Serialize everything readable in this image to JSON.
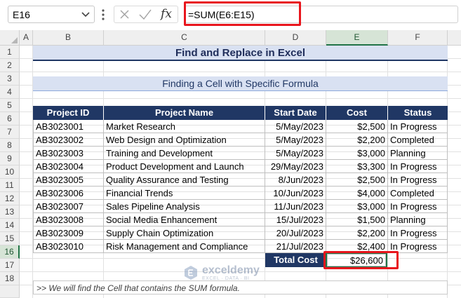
{
  "formula_bar": {
    "name_box": "E16",
    "formula": "=SUM(E6:E15)",
    "icons": [
      "chevron-down-icon",
      "kebab-icon",
      "cancel-x-icon",
      "enter-check-icon",
      "fx-icon"
    ]
  },
  "columns": [
    "A",
    "B",
    "C",
    "D",
    "E",
    "F"
  ],
  "rows": [
    "1",
    "2",
    "3",
    "4",
    "5",
    "6",
    "7",
    "8",
    "9",
    "10",
    "11",
    "12",
    "13",
    "14",
    "15",
    "16",
    "17",
    "18"
  ],
  "selected_column": "E",
  "selected_row": "16",
  "title": "Find and Replace in Excel",
  "subtitle": "Finding a Cell with Specific Formula",
  "table": {
    "headers": [
      "Project ID",
      "Project Name",
      "Start Date",
      "Cost",
      "Status"
    ],
    "rows": [
      [
        "AB3023001",
        "Market Research",
        "5/May/2023",
        "$2,500",
        "In Progress"
      ],
      [
        "AB3023002",
        "Web Design and Optimization",
        "5/May/2023",
        "$2,200",
        "Completed"
      ],
      [
        "AB3023003",
        "Training and Development",
        "5/May/2023",
        "$3,000",
        "Planning"
      ],
      [
        "AB3023004",
        "Product Development and Launch",
        "29/May/2023",
        "$3,300",
        "In Progress"
      ],
      [
        "AB3023005",
        "Quality Assurance and Testing",
        "8/Jun/2023",
        "$2,500",
        "In Progress"
      ],
      [
        "AB3023006",
        "Financial Trends",
        "10/Jun/2023",
        "$4,000",
        "Completed"
      ],
      [
        "AB3023007",
        "Sales Pipeline Analysis",
        "11/Jun/2023",
        "$3,000",
        "In Progress"
      ],
      [
        "AB3023008",
        "Social Media Enhancement",
        "15/Jul/2023",
        "$1,500",
        "Planning"
      ],
      [
        "AB3023009",
        "Supply Chain Optimization",
        "20/Jul/2023",
        "$2,200",
        "In Progress"
      ],
      [
        "AB3023010",
        "Risk Management and Compliance",
        "21/Jul/2023",
        "$2,400",
        "In Progress"
      ]
    ],
    "total_label": "Total Cost",
    "total_value": "$26,600"
  },
  "note": ">> We will find the Cell that contains the SUM formula.",
  "watermark": {
    "name": "exceldemy",
    "tagline": "EXCEL · DATA · BI"
  },
  "colors": {
    "header_fill": "#203764",
    "title_fill": "#d9e1f2",
    "highlight": "#e8161d",
    "selection": "#217346"
  }
}
